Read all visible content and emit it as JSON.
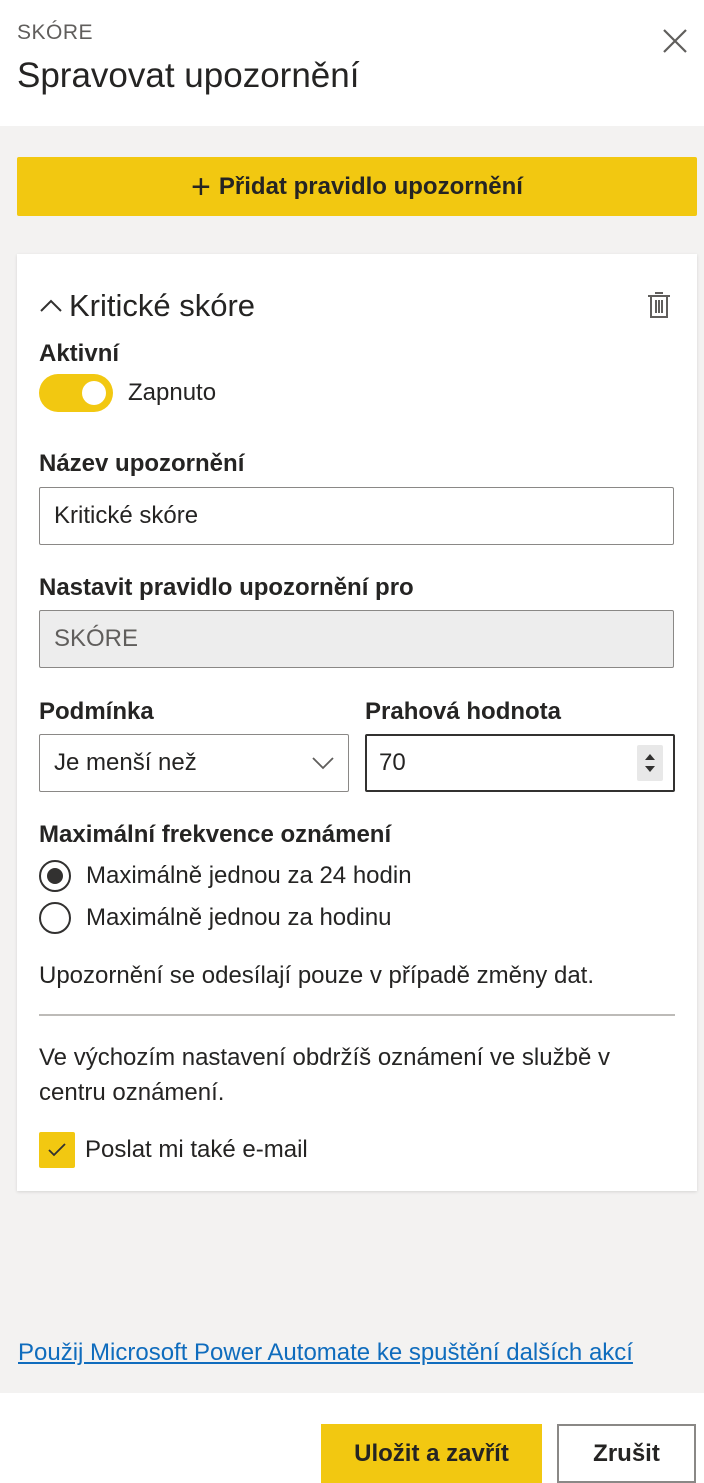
{
  "header": {
    "eyebrow": "SKÓRE",
    "title": "Spravovat upozornění"
  },
  "actions": {
    "add_rule_label": "Přidat pravidlo upozornění"
  },
  "rule": {
    "name": "Kritické skóre",
    "active_label": "Aktivní",
    "active_state": "Zapnuto",
    "active": true,
    "alert_name_label": "Název upozornění",
    "alert_name_value": "Kritické skóre",
    "rule_for_label": "Nastavit pravidlo upozornění pro",
    "rule_for_value": "SKÓRE",
    "condition_label": "Podmínka",
    "condition_value": "Je menší než",
    "threshold_label": "Prahová hodnota",
    "threshold_value": "70",
    "frequency_label": "Maximální frekvence oznámení",
    "frequency_options": [
      {
        "label": "Maximálně jednou za 24 hodin",
        "checked": true
      },
      {
        "label": "Maximálně jednou za hodinu",
        "checked": false
      }
    ],
    "data_change_note": "Upozornění se odesílají pouze v případě změny dat.",
    "default_note": "Ve výchozím nastavení obdržíš oznámení ve službě v centru oznámení.",
    "email_label": "Poslat mi také e-mail",
    "email_checked": true
  },
  "automate_link": "Použij Microsoft Power Automate ke spuštění dalších akcí",
  "footer": {
    "save_label": "Uložit a zavřít",
    "cancel_label": "Zrušit"
  },
  "colors": {
    "accent": "#f2c811",
    "link": "#0f6cbd",
    "background": "#f3f2f1"
  },
  "icons": {
    "close": "close-icon",
    "add": "plus-icon",
    "collapse": "chevron-up-icon",
    "delete": "trash-icon",
    "dropdown": "chevron-down-icon",
    "check": "checkmark-icon"
  }
}
